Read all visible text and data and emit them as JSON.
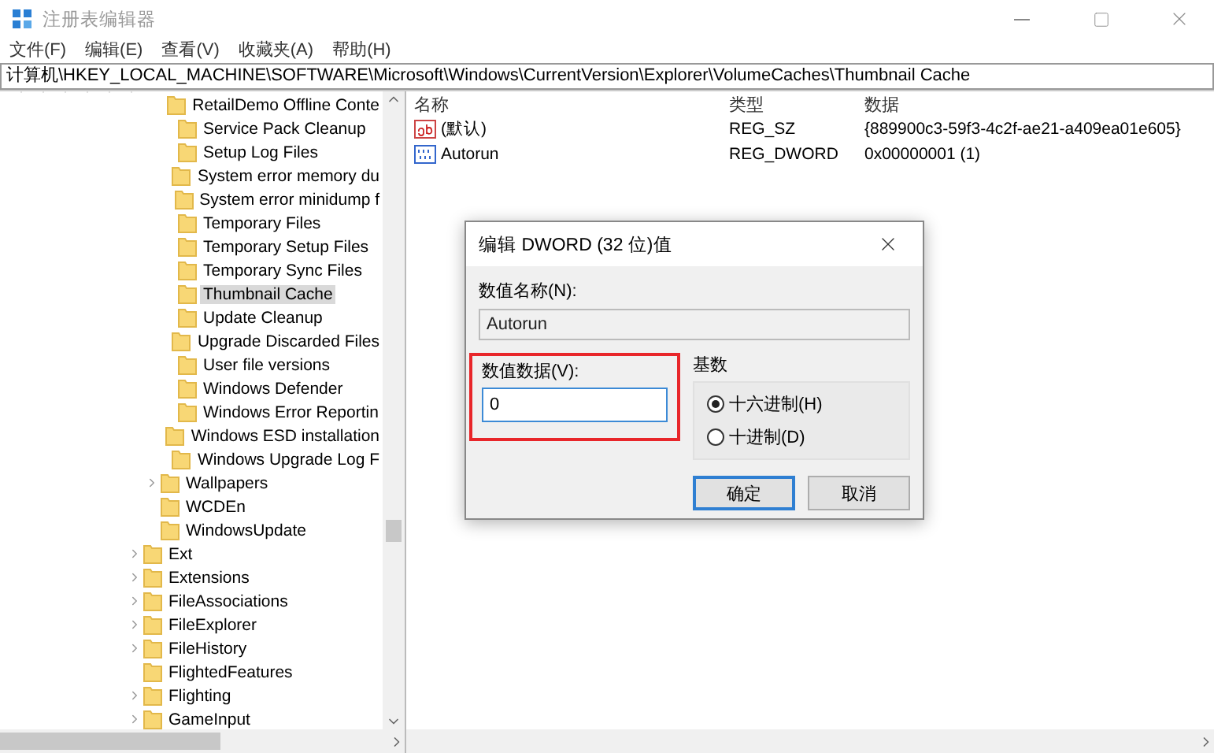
{
  "window": {
    "title": "注册表编辑器"
  },
  "menu": [
    {
      "label": "文件(F)"
    },
    {
      "label": "编辑(E)"
    },
    {
      "label": "查看(V)"
    },
    {
      "label": "收藏夹(A)"
    },
    {
      "label": "帮助(H)"
    }
  ],
  "address": "计算机\\HKEY_LOCAL_MACHINE\\SOFTWARE\\Microsoft\\Windows\\CurrentVersion\\Explorer\\VolumeCaches\\Thumbnail Cache",
  "tree": {
    "items": [
      {
        "children": [
          {
            "children": [
              {
                "label": "RetailDemo Offline Conte",
                "expandable": false,
                "selected": false
              },
              {
                "label": "Service Pack Cleanup",
                "expandable": false,
                "selected": false
              },
              {
                "label": "Setup Log Files",
                "expandable": false,
                "selected": false
              },
              {
                "label": "System error memory du",
                "expandable": false,
                "selected": false
              },
              {
                "label": "System error minidump f",
                "expandable": false,
                "selected": false
              },
              {
                "label": "Temporary Files",
                "expandable": false,
                "selected": false
              },
              {
                "label": "Temporary Setup Files",
                "expandable": false,
                "selected": false
              },
              {
                "label": "Temporary Sync Files",
                "expandable": false,
                "selected": false
              },
              {
                "label": "Thumbnail Cache",
                "expandable": false,
                "selected": true
              },
              {
                "label": "Update Cleanup",
                "expandable": false,
                "selected": false
              },
              {
                "label": "Upgrade Discarded Files",
                "expandable": false,
                "selected": false
              },
              {
                "label": "User file versions",
                "expandable": false,
                "selected": false
              },
              {
                "label": "Windows Defender",
                "expandable": false,
                "selected": false
              },
              {
                "label": "Windows Error Reportin",
                "expandable": false,
                "selected": false
              },
              {
                "label": "Windows ESD installation",
                "expandable": false,
                "selected": false
              },
              {
                "label": "Windows Upgrade Log F",
                "expandable": false,
                "selected": false
              }
            ]
          },
          {
            "label": "Wallpapers",
            "expandable": true,
            "selected": false
          },
          {
            "label": "WCDEn",
            "expandable": false,
            "selected": false
          },
          {
            "label": "WindowsUpdate",
            "expandable": false,
            "selected": false
          }
        ]
      },
      {
        "label": "Ext",
        "expandable": true,
        "selected": false
      },
      {
        "label": "Extensions",
        "expandable": true,
        "selected": false
      },
      {
        "label": "FileAssociations",
        "expandable": true,
        "selected": false
      },
      {
        "label": "FileExplorer",
        "expandable": true,
        "selected": false
      },
      {
        "label": "FileHistory",
        "expandable": true,
        "selected": false
      },
      {
        "label": "FlightedFeatures",
        "expandable": false,
        "selected": false
      },
      {
        "label": "Flighting",
        "expandable": true,
        "selected": false
      },
      {
        "label": "GameInput",
        "expandable": true,
        "selected": false
      }
    ]
  },
  "list": {
    "columns": [
      "名称",
      "类型",
      "数据"
    ],
    "rows": [
      {
        "kind": "string",
        "name": "(默认)",
        "type": "REG_SZ",
        "data": "{889900c3-59f3-4c2f-ae21-a409ea01e605}"
      },
      {
        "kind": "dword",
        "name": "Autorun",
        "type": "REG_DWORD",
        "data": "0x00000001 (1)"
      }
    ]
  },
  "dialog": {
    "title": "编辑 DWORD (32 位)值",
    "name_label": "数值名称(N):",
    "name_value": "Autorun",
    "data_label": "数值数据(V):",
    "data_value": "0",
    "highlighted": true,
    "base_label": "基数",
    "bases": [
      {
        "label": "十六进制(H)",
        "selected": true
      },
      {
        "label": "十进制(D)",
        "selected": false
      }
    ],
    "buttons": [
      {
        "label": "确定",
        "default": true
      },
      {
        "label": "取消",
        "default": false
      }
    ]
  }
}
